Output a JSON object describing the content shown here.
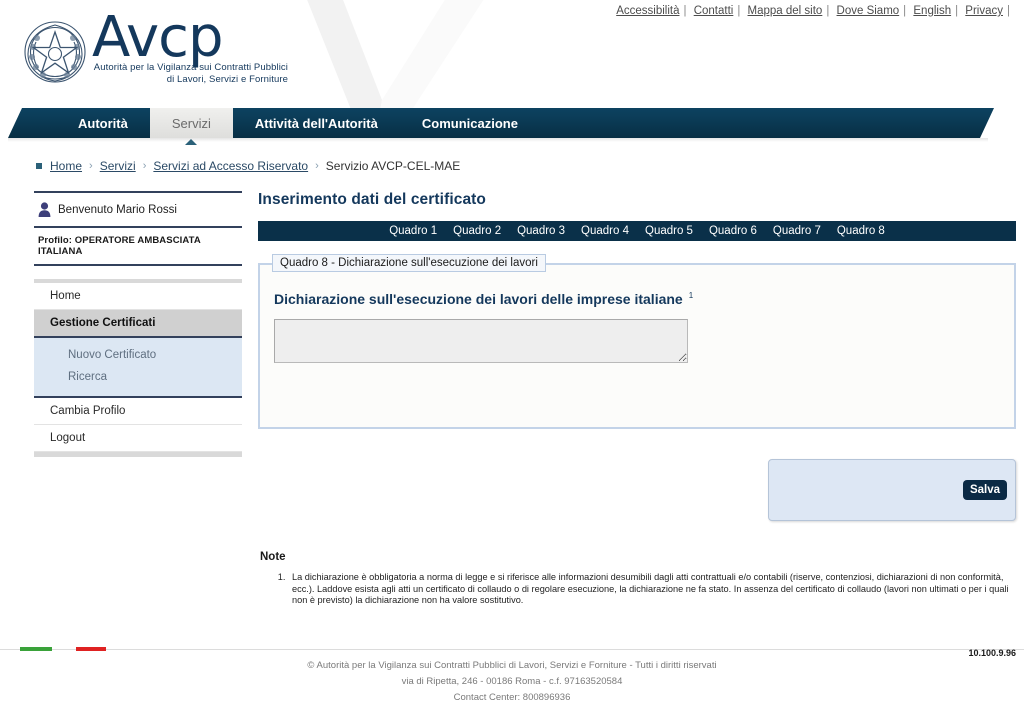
{
  "header": {
    "logo_text": "Avcp",
    "logo_subtitle_line1": "Autorità per la Vigilanza sui Contratti Pubblici",
    "logo_subtitle_line2": "di Lavori, Servizi e Forniture",
    "emblem_name": "italian-republic-emblem",
    "top_links": [
      {
        "label": "Accessibilità"
      },
      {
        "label": "Contatti"
      },
      {
        "label": "Mappa del sito"
      },
      {
        "label": "Dove Siamo"
      },
      {
        "label": "English"
      },
      {
        "label": "Privacy"
      }
    ],
    "link_separator": "|"
  },
  "nav": {
    "items": [
      {
        "label": "Autorità",
        "active": false
      },
      {
        "label": "Servizi",
        "active": true
      },
      {
        "label": "Attività dell'Autorità",
        "active": false
      },
      {
        "label": "Comunicazione",
        "active": false
      }
    ]
  },
  "breadcrumb": {
    "items": [
      {
        "label": "Home",
        "link": true
      },
      {
        "label": "Servizi",
        "link": true
      },
      {
        "label": "Servizi ad Accesso Riservato",
        "link": true
      },
      {
        "label": "Servizio AVCP-CEL-MAE",
        "link": false
      }
    ],
    "separator": "›"
  },
  "sidebar": {
    "welcome": "Benvenuto Mario Rossi",
    "profile": "Profilo: OPERATORE AMBASCIATA ITALIANA",
    "menu": [
      {
        "label": "Home",
        "selected": false
      },
      {
        "label": "Gestione Certificati",
        "selected": true
      }
    ],
    "submenu": [
      {
        "label": "Nuovo Certificato"
      },
      {
        "label": "Ricerca"
      }
    ],
    "menu_bottom": [
      {
        "label": "Cambia Profilo"
      },
      {
        "label": "Logout"
      }
    ]
  },
  "main": {
    "page_title": "Inserimento dati del certificato",
    "quadro_tabs": [
      {
        "label": "Quadro 1"
      },
      {
        "label": "Quadro 2"
      },
      {
        "label": "Quadro 3"
      },
      {
        "label": "Quadro 4"
      },
      {
        "label": "Quadro 5"
      },
      {
        "label": "Quadro 6"
      },
      {
        "label": "Quadro 7"
      },
      {
        "label": "Quadro 8"
      }
    ],
    "fieldset_legend": "Quadro 8 - Dichiarazione sull'esecuzione dei lavori",
    "declaration_title": "Dichiarazione sull'esecuzione dei lavori delle imprese italiane",
    "declaration_footnote_ref": "1",
    "declaration_value": "",
    "declaration_placeholder": "",
    "save_label": "Salva"
  },
  "notes": {
    "title": "Note",
    "items": [
      "La dichiarazione è obbligatoria a norma di legge e si riferisce alle informazioni desumibili dagli atti contrattuali e/o contabili (riserve, contenziosi, dichiarazioni di non conformità, ecc.). Laddove esista agli atti un certificato di collaudo o di regolare esecuzione, la dichiarazione ne fa stato. In assenza del certificato di collaudo (lavori non ultimati o per i quali non è previsto) la dichiarazione non ha valore sostitutivo."
    ]
  },
  "footer": {
    "ip_address": "10.100.9.96",
    "line1": "© Autorità per la Vigilanza sui Contratti Pubblici di Lavori, Servizi e Forniture - Tutti i diritti riservati",
    "line2": "via di Ripetta, 246 - 00186 Roma - c.f. 97163520584",
    "line3": "Contact Center: 800896936"
  },
  "colors": {
    "brand_dark": "#14385c",
    "nav_bg": "#0b3b56",
    "quadro_bar": "#0a3049",
    "accent_panel": "#dde7f4",
    "flag_green": "#3aa23a",
    "flag_red": "#df2222"
  }
}
